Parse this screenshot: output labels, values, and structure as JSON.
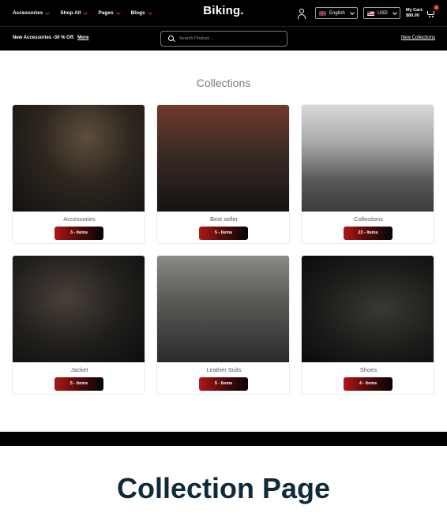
{
  "header": {
    "nav": [
      {
        "label": "Accessories"
      },
      {
        "label": "Shop All"
      },
      {
        "label": "Pages"
      },
      {
        "label": "Blogs"
      }
    ],
    "logo": "Biking.",
    "language": "English",
    "currency": "USD",
    "cart_label": "My Cart:",
    "cart_total": "$80.00",
    "cart_count": "4"
  },
  "subbar": {
    "promo_text": "New Accessories -30 % Off.",
    "promo_link": "More",
    "search_placeholder": "Search Product...",
    "new_collections": "New Collections"
  },
  "collections": {
    "title": "Collections",
    "items": [
      {
        "name": "Accessories",
        "count": "3 - Items"
      },
      {
        "name": "Best seller",
        "count": "5 - Items"
      },
      {
        "name": "Collections",
        "count": "23 - Items"
      },
      {
        "name": "Jacket",
        "count": "5 - Items"
      },
      {
        "name": "Leather Suits",
        "count": "5 - Items"
      },
      {
        "name": "Shoes",
        "count": "4 - Items"
      }
    ]
  },
  "caption": "Collection Page",
  "colors": {
    "accent": "#c62828",
    "caption": "#0f2a3a",
    "header_bg": "#000000"
  }
}
